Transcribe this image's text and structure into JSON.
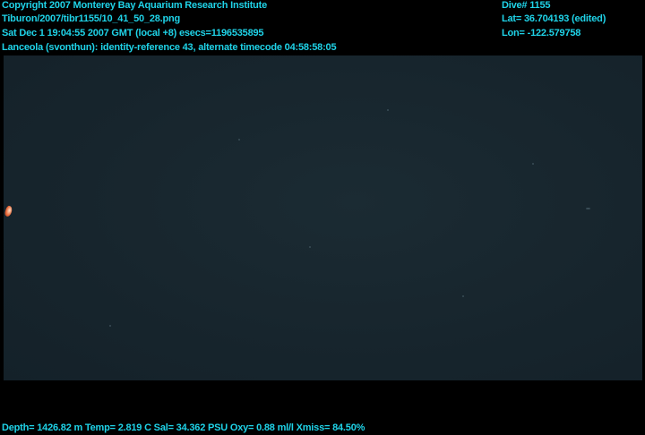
{
  "overlay": {
    "text_color": "#1fd3e8",
    "background_color": "#000000",
    "copyright": "Copyright 2007 Monterey Bay Aquarium Research Institute",
    "file_path": "Tiburon/2007/tibr1155/10_41_50_28.png",
    "datetime": "Sat Dec  1 19:04:55 2007 GMT (local +8)  esecs=1196535895",
    "annotation": "Lanceola (svonthun): identity-reference 43, alternate timecode 04:58:58:05",
    "dive": "Dive# 1155",
    "latitude": "Lat= 36.704193 (edited)",
    "longitude": "Lon= -122.579758",
    "telemetry": "Depth= 1426.82 m  Temp= 2.819 C  Sal= 34.362 PSU  Oxy= 0.88 ml/l  Xmiss= 84.50%"
  },
  "scene": {
    "water_color": "#17252d",
    "subject_color": "#e86a3a"
  }
}
